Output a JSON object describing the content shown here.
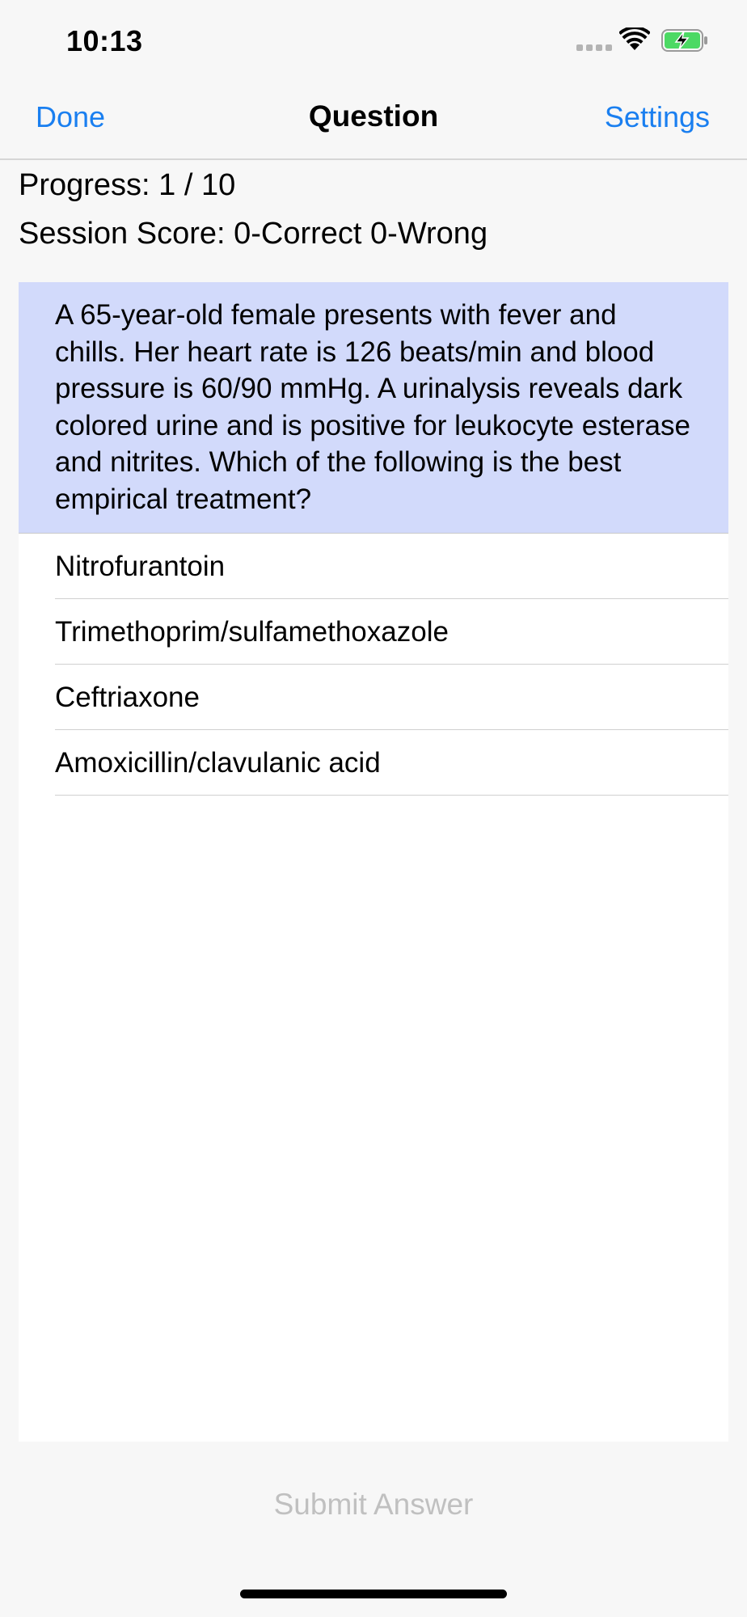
{
  "status_bar": {
    "time": "10:13",
    "icons": [
      "cellular-signal-icon",
      "wifi-icon",
      "battery-charging-icon"
    ]
  },
  "nav": {
    "left_button": "Done",
    "title": "Question",
    "right_button": "Settings"
  },
  "session": {
    "progress": "Progress: 1 / 10",
    "score": "Session Score: 0-Correct 0-Wrong"
  },
  "question": {
    "text": "A 65-year-old female presents with fever and chills. Her heart rate is 126 beats/min and blood pressure is 60/90 mmHg. A urinalysis reveals dark colored urine and is positive for leukocyte esterase and nitrites. Which of the following is the best empirical treatment?",
    "answers": [
      "Nitrofurantoin",
      "Trimethoprim/sulfamethoxazole",
      "Ceftriaxone",
      "Amoxicillin/clavulanic acid"
    ]
  },
  "submit_label": "Submit Answer",
  "colors": {
    "accent": "#1a7ff0",
    "question_background": "#d2dafb",
    "disabled_text": "#c0c0c0",
    "battery_green": "#4cd964"
  }
}
